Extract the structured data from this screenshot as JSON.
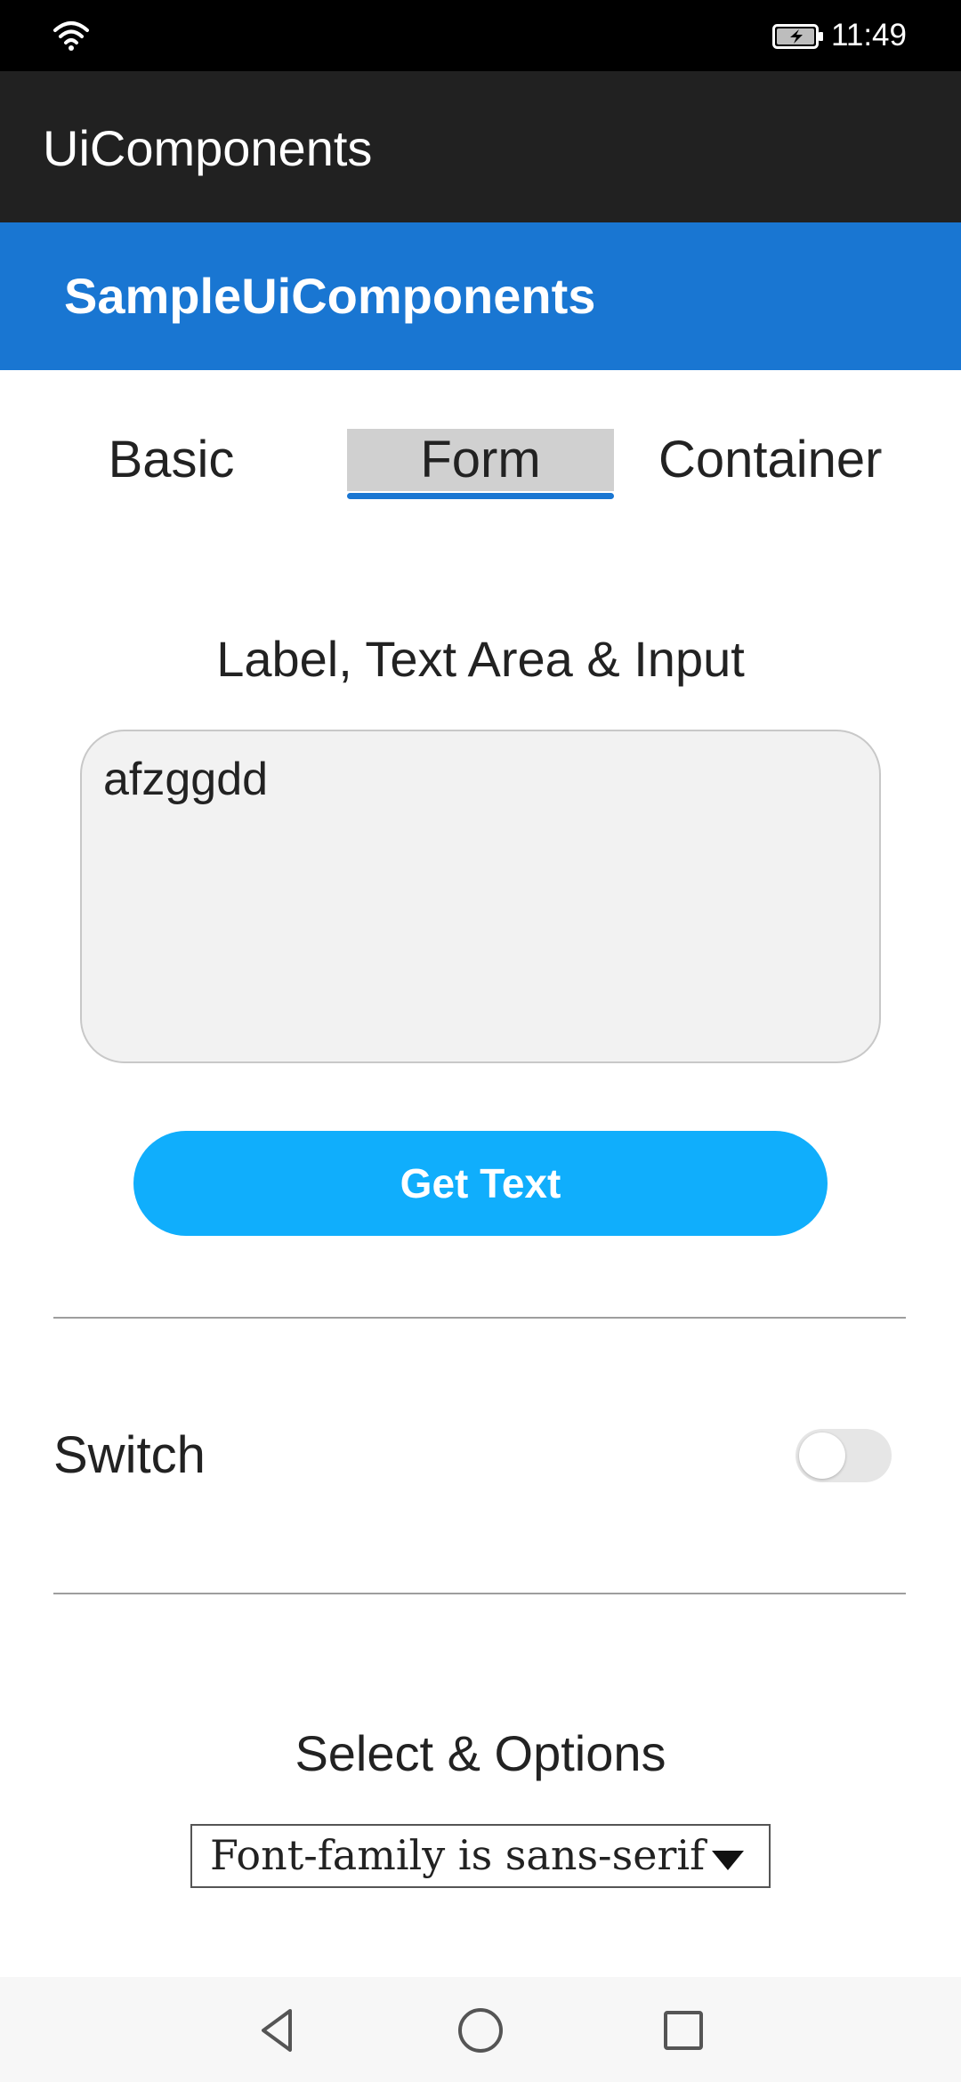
{
  "status_bar": {
    "time": "11:49",
    "icons": [
      "wifi-icon",
      "battery-charging-icon"
    ]
  },
  "app_bar": {
    "title": "UiComponents"
  },
  "page_header": {
    "title": "SampleUiComponents"
  },
  "tabs": {
    "items": [
      {
        "label": "Basic",
        "selected": false
      },
      {
        "label": "Form",
        "selected": true
      },
      {
        "label": "Container",
        "selected": false
      }
    ],
    "accent_color": "#1976d2"
  },
  "form": {
    "textarea_section_title": "Label, Text Area & Input",
    "textarea_value": "afzggdd",
    "get_text_button_label": "Get Text",
    "button_color": "#10aefc",
    "switch_label": "Switch",
    "switch_on": false,
    "select_section_title": "Select & Options",
    "select_value": "Font-family is sans-serif"
  },
  "nav_bar": {
    "icons": [
      "back-icon",
      "home-icon",
      "recents-icon"
    ]
  }
}
